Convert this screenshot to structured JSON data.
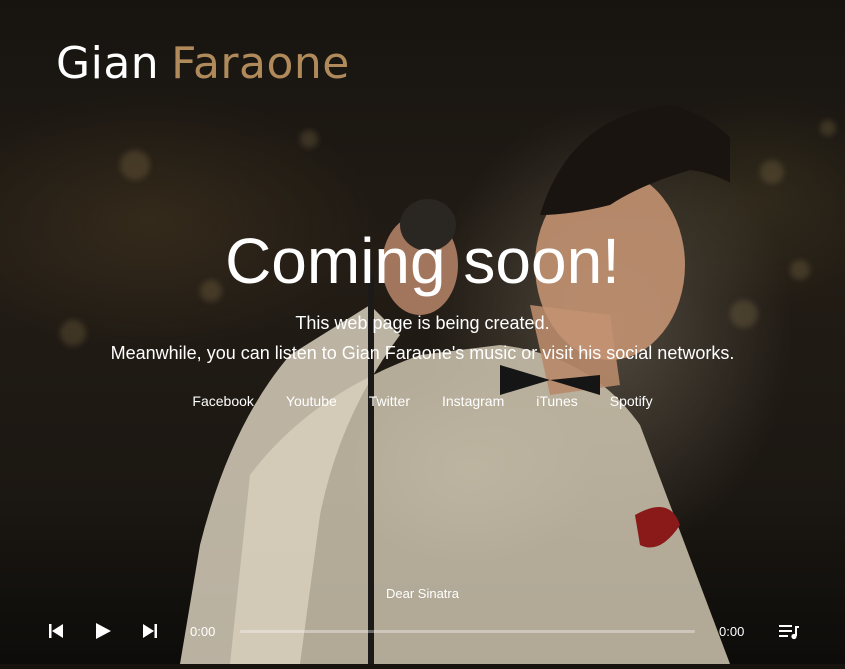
{
  "logo": {
    "first": "Gian",
    "last": "Faraone"
  },
  "headline": "Coming soon!",
  "sub1": "This web page is being created.",
  "sub2": "Meanwhile, you can listen to Gian Faraone's music or visit his social networks.",
  "social": [
    {
      "label": "Facebook"
    },
    {
      "label": "Youtube"
    },
    {
      "label": "Twitter"
    },
    {
      "label": "Instagram"
    },
    {
      "label": "iTunes"
    },
    {
      "label": "Spotify"
    }
  ],
  "player": {
    "track_title": "Dear Sinatra",
    "current_time": "0:00",
    "duration": "0:00",
    "progress": 0
  },
  "colors": {
    "accent": "#b08a5a",
    "text": "#ffffff"
  }
}
